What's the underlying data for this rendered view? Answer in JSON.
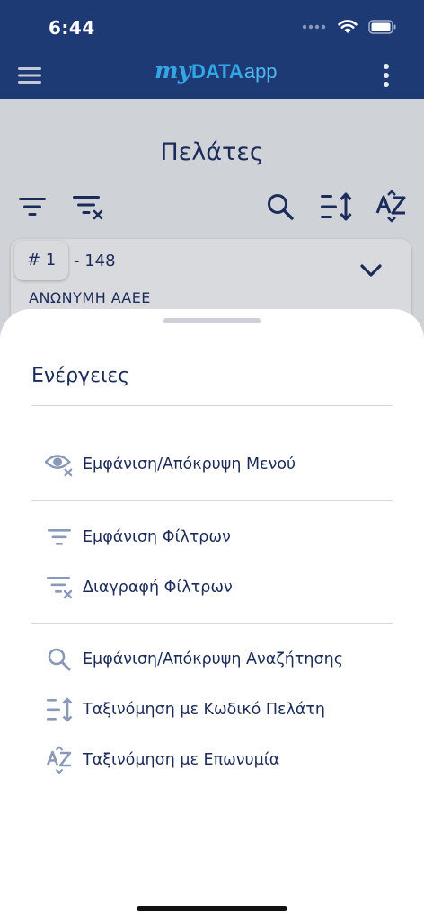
{
  "status_bar": {
    "time": "6:44"
  },
  "app_bar": {
    "logo": {
      "part1": "my",
      "part2": "DATA",
      "part3": "app"
    },
    "menu_icon": "hamburger-icon",
    "more_icon": "more-vertical-icon"
  },
  "page": {
    "title": "Πελάτες",
    "toolbar": [
      "filter-icon",
      "clear-filter-icon",
      "search-icon",
      "sort-numeric-icon",
      "sort-az-icon"
    ]
  },
  "customer_card": {
    "number": "# 1",
    "code": "- 148",
    "name": "ΑΝΩΝΥΜΗ ΑΑΕΕ"
  },
  "sheet": {
    "title": "Ενέργειες",
    "actions": [
      {
        "label": "Εμφάνιση/Απόκρυψη Μενού",
        "icon": "eye-off-icon"
      },
      {
        "label": "Εμφάνιση Φίλτρων",
        "icon": "filter-icon"
      },
      {
        "label": "Διαγραφή Φίλτρων",
        "icon": "clear-filter-icon"
      },
      {
        "label": "Εμφάνιση/Απόκρυψη Αναζήτησης",
        "icon": "search-icon"
      },
      {
        "label": "Ταξινόμηση με Κωδικό Πελάτη",
        "icon": "sort-numeric-icon"
      },
      {
        "label": "Ταξινόμηση με Επωνυμία",
        "icon": "sort-az-icon"
      }
    ]
  },
  "colors": {
    "header": "#1d3a74",
    "accent": "#34a6e8",
    "text": "#1c2c5a",
    "overlay": "#cfd2d7",
    "icon_muted": "#8a99b8"
  }
}
